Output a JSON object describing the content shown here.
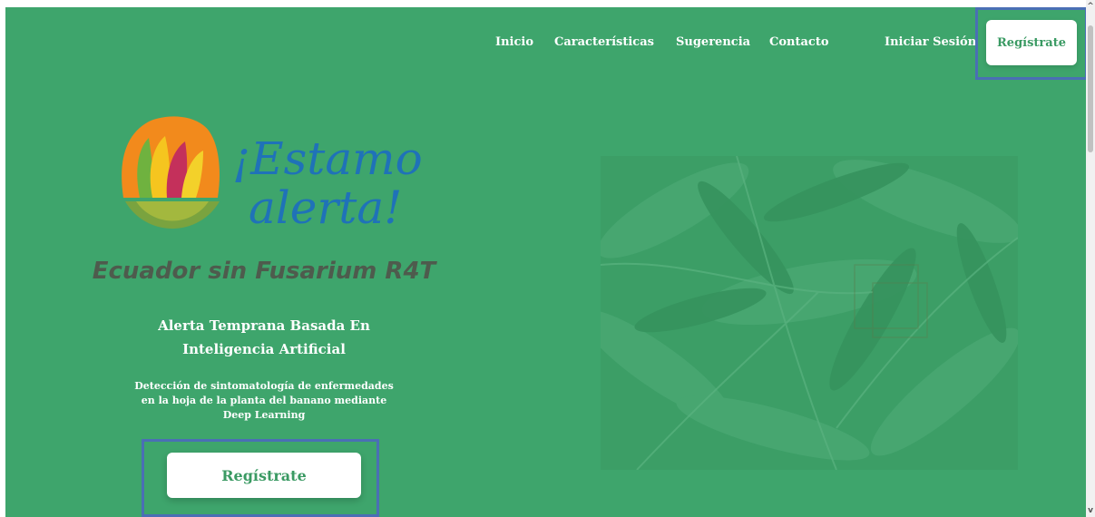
{
  "nav": {
    "items": [
      {
        "label": "Inicio"
      },
      {
        "label": "Características"
      },
      {
        "label": "Sugerencia"
      },
      {
        "label": "Contacto"
      }
    ],
    "login_label": "Iniciar Sesión",
    "register_label": "Regístrate"
  },
  "logo": {
    "text_line1": "¡Estamos",
    "text_line2": "alerta!"
  },
  "hero": {
    "subtitle": "Ecuador sin Fusarium R4T",
    "headline_line1": "Alerta Temprana Basada En",
    "headline_line2": "Inteligencia Artificial",
    "desc_line1": "Detección de sintomatología de enfermedades",
    "desc_line2": "en la hoja de la planta del banano mediante",
    "desc_line3": "Deep Learning",
    "cta_label": "Regístrate"
  },
  "colors": {
    "background": "#3ea56c",
    "button_text": "#3a9a63",
    "highlight_border": "#4a6fb5",
    "logo_blue": "#1f72b8",
    "logo_orange": "#f28a1c"
  }
}
